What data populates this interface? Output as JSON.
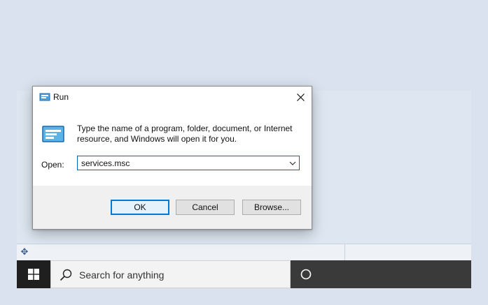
{
  "dialog": {
    "title": "Run",
    "message": "Type the name of a program, folder, document, or Internet resource, and Windows will open it for you.",
    "open_label": "Open:",
    "open_value": "services.msc",
    "ok_label": "OK",
    "cancel_label": "Cancel",
    "browse_label": "Browse..."
  },
  "taskbar": {
    "search_placeholder": "Search for anything"
  },
  "icons": {
    "title": "run-icon",
    "close": "close-icon",
    "dropdown": "chevron-down-icon",
    "start": "windows-logo-icon",
    "search": "search-icon",
    "cortana": "cortana-circle-icon",
    "move": "move-icon"
  },
  "colors": {
    "accent": "#0078d7",
    "taskbar": "#1f1f1f",
    "desktop": "#d9e2ee"
  }
}
